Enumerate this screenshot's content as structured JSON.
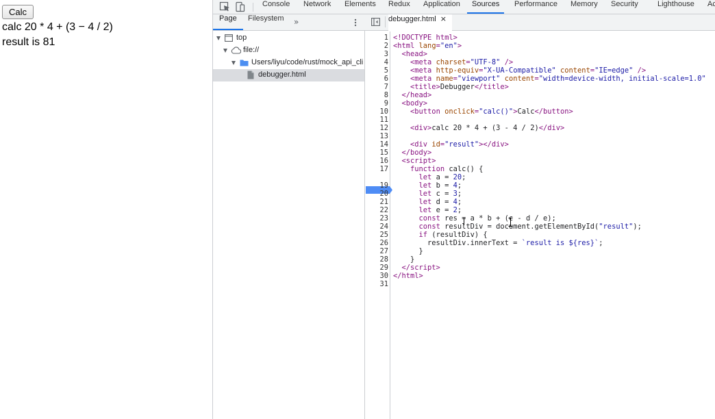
{
  "page": {
    "calc_button": "Calc",
    "expression": "calc 20 * 4 + (3 − 4 / 2)",
    "result": "result is 81"
  },
  "devtools": {
    "toolbar_icons": [
      "inspect-element-icon",
      "device-toolbar-icon"
    ],
    "panel_tabs": [
      "Console",
      "Network",
      "Elements",
      "Redux",
      "Application",
      "Sources",
      "Performance",
      "Memory",
      "Security",
      "Lighthouse",
      "Ac"
    ],
    "active_panel": "Sources",
    "navigator": {
      "tabs": [
        "Page",
        "Filesystem"
      ],
      "more": "»",
      "tree": {
        "top": "top",
        "file": "file://",
        "folder": "Users/liyu/code/rust/mock_api_cli",
        "file_name": "debugger.html"
      }
    },
    "editor": {
      "file_tab": "debugger.html",
      "close_glyph": "×",
      "breakpoint_line": 18,
      "line_count": 31
    }
  },
  "colors": {
    "accent": "#1a73e8",
    "breakpoint": "#4e8cf5",
    "tag": "#881280",
    "attribute": "#994500",
    "string": "#1a1aa6",
    "folder": "#4b8ef1"
  }
}
